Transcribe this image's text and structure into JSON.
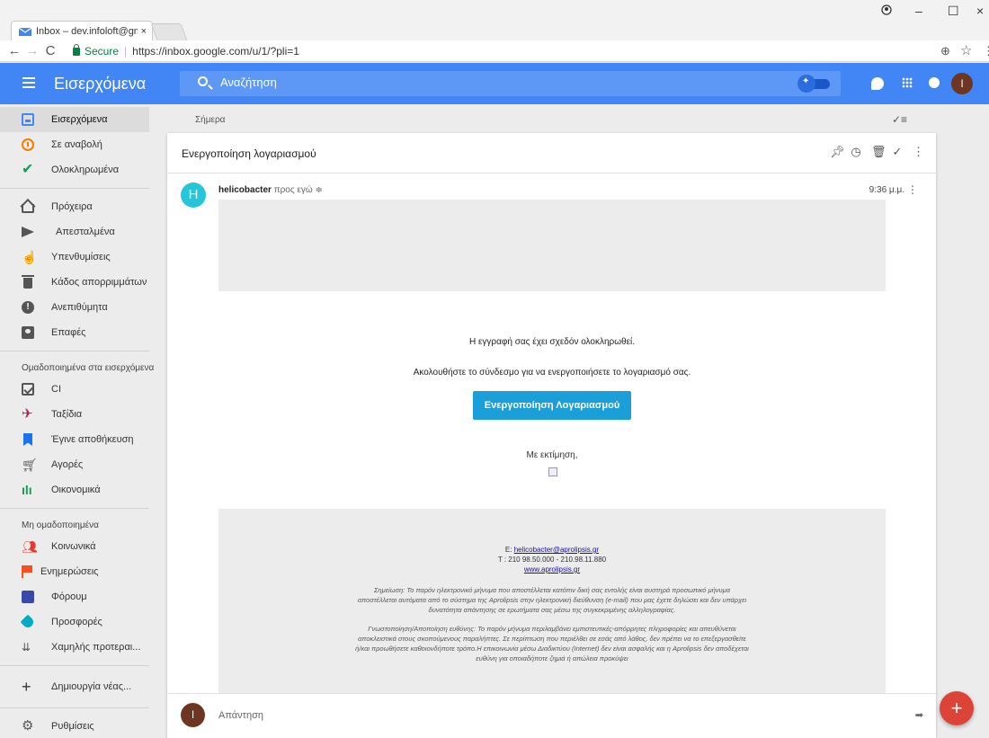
{
  "browser": {
    "tab_title": "Inbox – dev.infoloft@gm",
    "tab_close": "×",
    "secure_label": "Secure",
    "url": "https://inbox.google.com/u/1/?pli=1",
    "controls": {
      "minimize": "–",
      "maximize": "☐",
      "close": "×"
    }
  },
  "header": {
    "title": "Εισερχόμενα",
    "search_placeholder": "Αναζήτηση",
    "avatar_letter": "I"
  },
  "sidebar": {
    "primary": [
      {
        "label": "Εισερχόμενα",
        "icon": "inbox-icon"
      },
      {
        "label": "Σε αναβολή",
        "icon": "clock-icon"
      },
      {
        "label": "Ολοκληρωμένα",
        "icon": "check-icon"
      }
    ],
    "secondary": [
      {
        "label": "Πρόχειρα",
        "icon": "drafts-icon"
      },
      {
        "label": "Απεσταλμένα",
        "icon": "send-icon"
      },
      {
        "label": "Υπενθυμίσεις",
        "icon": "reminder-icon"
      },
      {
        "label": "Κάδος απορριμμάτων",
        "icon": "trash-icon"
      },
      {
        "label": "Ανεπιθύμητα",
        "icon": "spam-icon"
      },
      {
        "label": "Επαφές",
        "icon": "contacts-icon"
      }
    ],
    "bundled_title": "Ομαδοποιημένα στα εισερχόμενα",
    "bundled": [
      {
        "label": "CI",
        "icon": "ci-icon"
      },
      {
        "label": "Ταξίδια",
        "icon": "plane-icon"
      },
      {
        "label": "Έγινε αποθήκευση",
        "icon": "bookmark-icon"
      },
      {
        "label": "Αγορές",
        "icon": "cart-icon"
      },
      {
        "label": "Οικονομικά",
        "icon": "finance-icon"
      }
    ],
    "unbundled_title": "Μη ομαδοποιημένα",
    "unbundled": [
      {
        "label": "Κοινωνικά",
        "icon": "social-icon"
      },
      {
        "label": "Ενημερώσεις",
        "icon": "flag-icon"
      },
      {
        "label": "Φόρουμ",
        "icon": "forum-icon"
      },
      {
        "label": "Προσφορές",
        "icon": "tag-icon"
      },
      {
        "label": "Χαμηλής προτεραι...",
        "icon": "low-priority-icon"
      }
    ],
    "create_label": "Δημιουργία νέας...",
    "settings_label": "Ρυθμίσεις"
  },
  "main": {
    "date_group": "Σήμερα",
    "subject": "Ενεργοποίηση λογαριασμού",
    "sender_initial": "H",
    "sender_name": "helicobacter",
    "sender_to": "προς εγώ",
    "time": "9:36 μ.μ.",
    "body": {
      "line1": "Η εγγραφή σας έχει σχεδόν ολοκληρωθεί.",
      "line2": "Ακολουθήστε το σύνδεσμο για να ενεργοποιήσετε το λογαριασμό σας.",
      "cta": "Ενεργοποίηση Λογαριασμού",
      "regards": "Με εκτίμηση,"
    },
    "footer": {
      "email_prefix": "E: ",
      "email": "helicobacter@aprolipsis.gr",
      "phone": "T : 210 98.50.000 - 210.98.11.880",
      "website": "www.aprolipsis.gr",
      "note1": "Σημείωση: Το παρόν ηλεκτρονικό μήνυμα που αποστέλλεται κατόπιν δική σας εντολής είναι αυστηρά προσωπικό μήνυμα αποστέλλεται αυτόματα από το σύστημα της Aprolipsis στην ηλεκτρονική διεύθυνση (e-mail) που μας έχετε δηλώσει και δεν υπάρχει δυνατότητα απάντησης σε ερωτήματα σας μέσω της συγκεκριμένης αλληλογραφίας.",
      "note2": "Γνωστοποίηση/Αποποίηση ευθύνης: Το παρόν μήνυμα περιλαμβάνει εμπιστευτικές-απόρρητες πληροφορίες και απευθύνεται αποκλειστικά στους σκοπούμενους παραλήπτες. Σε περίπτωση που περιέλθει σε εσάς από λάθος, δεν πρέπει να το επεξεργασθείτε ή/και προωθήσετε καθοιονδήποτε τρόπο.Η επικοινωνία μέσω Διαδικτύου (Internet) δεν είναι ασφαλής και η Aprolipsis δεν αποδέχεται ευθύνη για οποιαδήποτε ζημιά ή απώλεια προκύψει"
    },
    "reply_label": "Απάντηση",
    "reply_avatar": "I"
  },
  "fab_label": "+",
  "colors": {
    "appbar": "#4285f4",
    "cta": "#1a9fd8",
    "fab": "#db4437",
    "sender_avatar": "#26c6da",
    "user_avatar": "#6d3522"
  }
}
